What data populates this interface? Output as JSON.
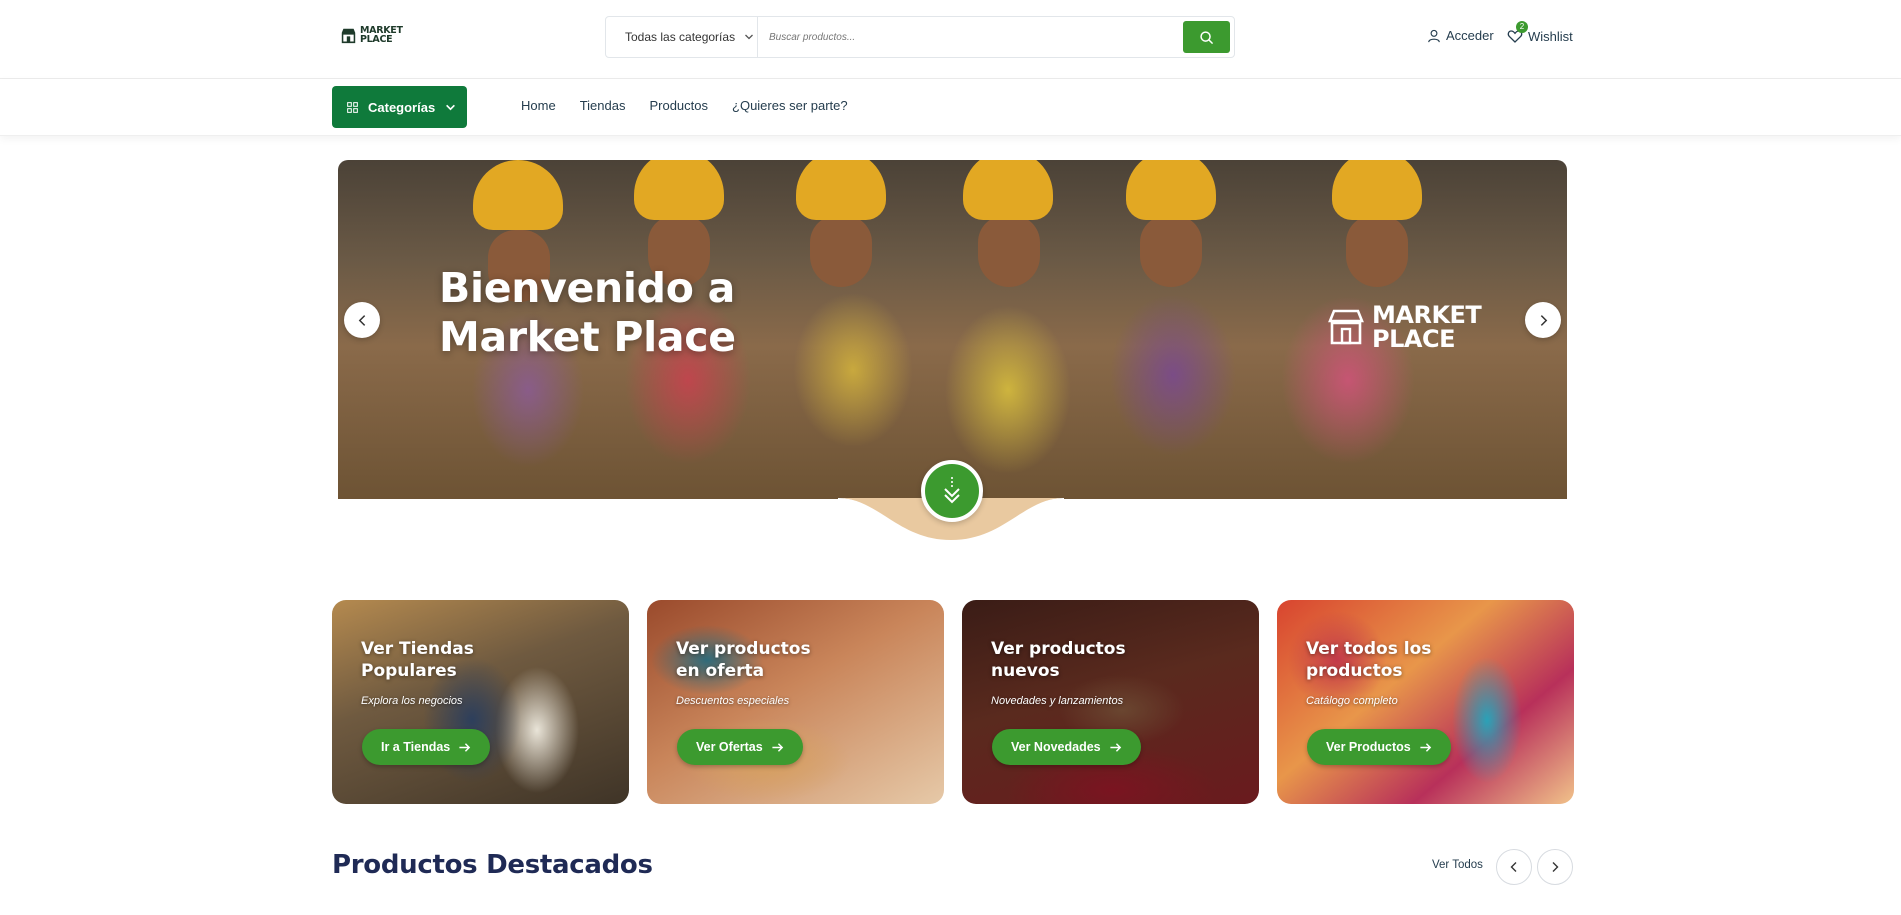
{
  "header": {
    "logo_line1": "MARKET",
    "logo_line2": "PLACE",
    "search": {
      "category_label": "Todas las categorías",
      "placeholder": "Buscar productos..."
    },
    "account_label": "Acceder",
    "wishlist_label": "Wishlist",
    "wishlist_count": "2"
  },
  "nav": {
    "categories_label": "Categorías",
    "links": [
      "Home",
      "Tiendas",
      "Productos",
      "¿Quieres ser parte?"
    ]
  },
  "hero": {
    "title_line1": "Bienvenido a",
    "title_line2": "Market Place",
    "logo_line1": "MARKET",
    "logo_line2": "PLACE"
  },
  "cards": [
    {
      "title_line1": "Ver Tiendas",
      "title_line2": "Populares",
      "subtitle": "Explora los negocios",
      "button": "Ir a Tiendas"
    },
    {
      "title_line1": "Ver productos",
      "title_line2": "en oferta",
      "subtitle": "Descuentos especiales",
      "button": "Ver Ofertas"
    },
    {
      "title_line1": "Ver productos",
      "title_line2": "nuevos",
      "subtitle": "Novedades y lanzamientos",
      "button": "Ver Novedades"
    },
    {
      "title_line1": "Ver todos los",
      "title_line2": "productos",
      "subtitle": "Catálogo completo",
      "button": "Ver Productos"
    }
  ],
  "featured": {
    "title": "Productos Destacados",
    "see_all": "Ver Todos"
  },
  "colors": {
    "primary_green": "#3c9a2f",
    "dark_green": "#0f7a3b",
    "heading_navy": "#1f2a55"
  }
}
